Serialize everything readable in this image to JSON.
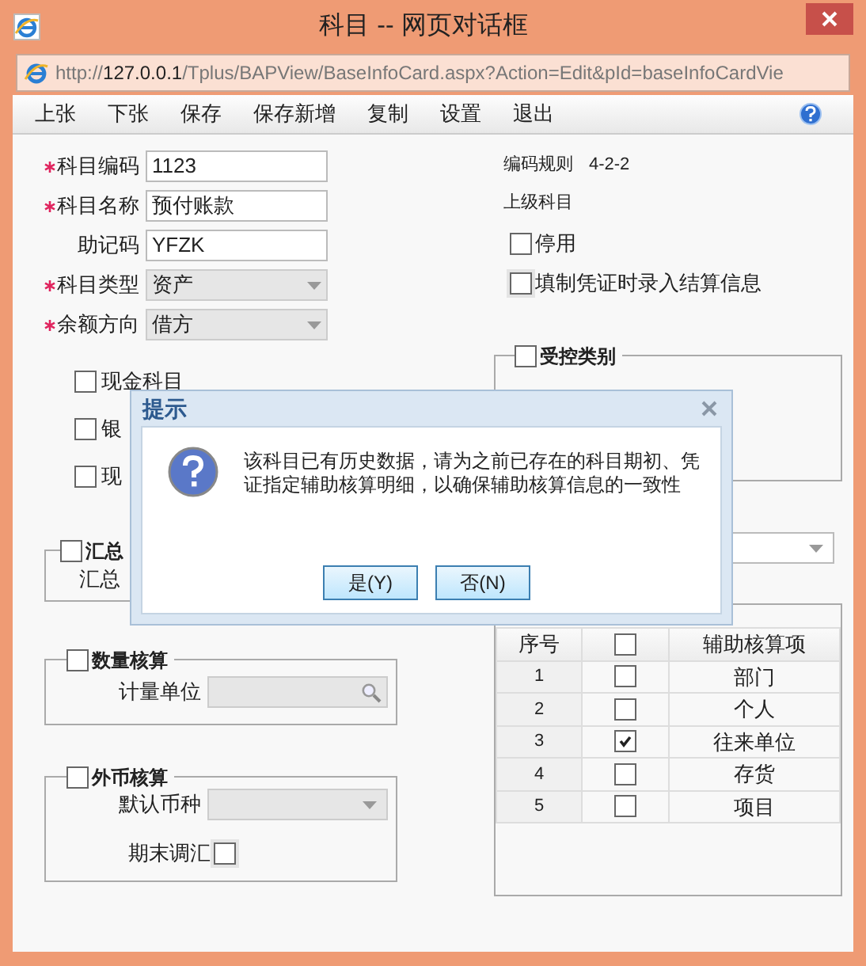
{
  "window": {
    "title": "科目 -- 网页对话框"
  },
  "address_bar": {
    "url": "http://**127.0.0.1**/Tplus/BAPView/BaseInfoCard.aspx?Action=Edit&pId=baseInfoCardVie"
  },
  "toolbar": {
    "items": [
      "上张",
      "下张",
      "保存",
      "保存新增",
      "复制",
      "设置",
      "退出"
    ]
  },
  "form": {
    "fields": [
      {
        "label": "科目编码",
        "required": true,
        "kind": "text",
        "value": "1123"
      },
      {
        "label": "科目名称",
        "required": true,
        "kind": "text",
        "value": "预付账款"
      },
      {
        "label": "助记码",
        "required": false,
        "kind": "text",
        "value": "YFZK"
      },
      {
        "label": "科目类型",
        "required": true,
        "kind": "select",
        "value": "资产"
      },
      {
        "label": "余额方向",
        "required": true,
        "kind": "select",
        "value": "借方"
      }
    ]
  },
  "left_options": [
    {
      "label": "现金科目",
      "checked": false
    },
    {
      "label": "银",
      "checked": false
    },
    {
      "label": "现",
      "checked": false
    }
  ],
  "summary_group": {
    "label": "汇总",
    "checked": false,
    "text": "汇总"
  },
  "quantity_group": {
    "label": "数量核算",
    "checked": false,
    "field_label": "计量单位"
  },
  "currency_group": {
    "label": "外币核算",
    "checked": false,
    "field_label": "默认币种",
    "adjust_label": "期末调汇",
    "adjust_checked": false
  },
  "info": {
    "coding_rule_label": "编码规则",
    "coding_rule": "4-2-2",
    "parent_label": "上级科目"
  },
  "right_options": [
    {
      "label": "停用",
      "checked": false
    },
    {
      "label": "填制凭证时录入结算信息",
      "checked": false
    }
  ],
  "controlled_group": {
    "label": "受控类别",
    "checked": false
  },
  "aux_table": {
    "columns": [
      "序号",
      "辅助核算项"
    ],
    "header_checked": false,
    "rows": [
      {
        "index": "1",
        "checked": false,
        "item": "部门"
      },
      {
        "index": "2",
        "checked": false,
        "item": "个人"
      },
      {
        "index": "3",
        "checked": true,
        "item": "往来单位"
      },
      {
        "index": "4",
        "checked": false,
        "item": "存货"
      },
      {
        "index": "5",
        "checked": false,
        "item": "项目"
      }
    ]
  },
  "dialog": {
    "title": "提示",
    "message": "该科目已有历史数据，请为之前已存在的科目期初、凭证指定辅助核算明细，以确保辅助核算信息的一致性",
    "buttons": [
      "是(Y)",
      "否(N)"
    ]
  }
}
